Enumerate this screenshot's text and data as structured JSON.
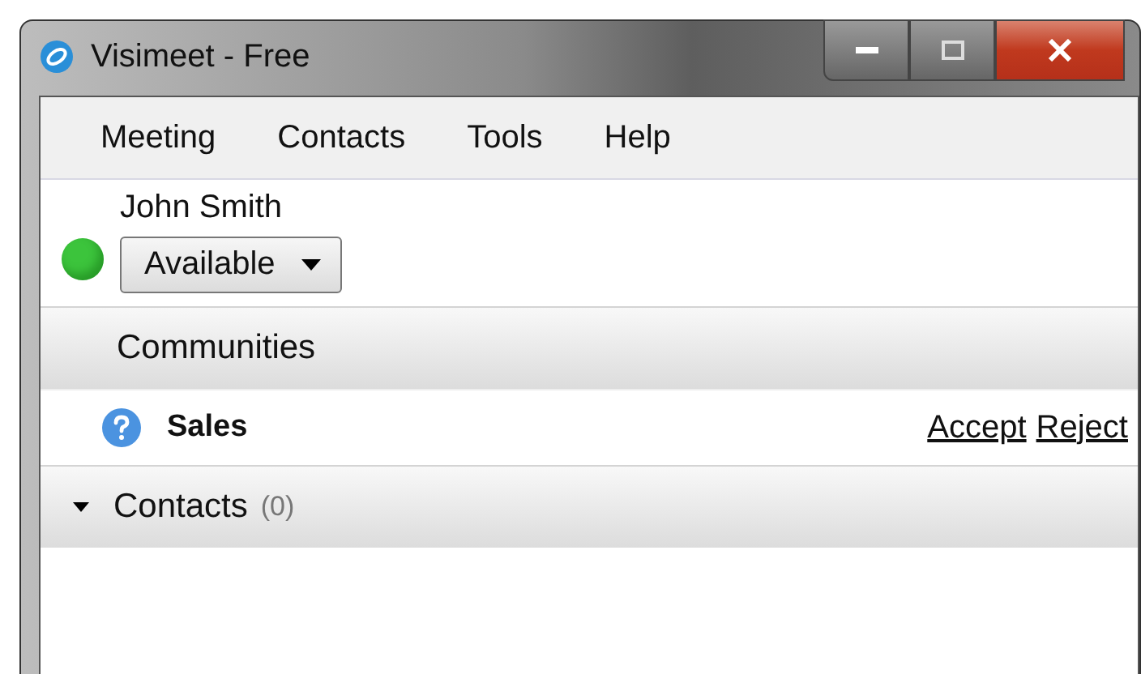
{
  "window": {
    "title": "Visimeet - Free"
  },
  "menu": [
    "Meeting",
    "Contacts",
    "Tools",
    "Help"
  ],
  "user": {
    "name": "John Smith",
    "status": "Available",
    "color": "#3cc43c"
  },
  "communities": {
    "title": "Communities",
    "items": [
      {
        "name": "Sales",
        "actions": [
          "Accept",
          "Reject"
        ]
      }
    ]
  },
  "contacts": {
    "title": "Contacts",
    "count": "(0)",
    "expanded": true
  }
}
